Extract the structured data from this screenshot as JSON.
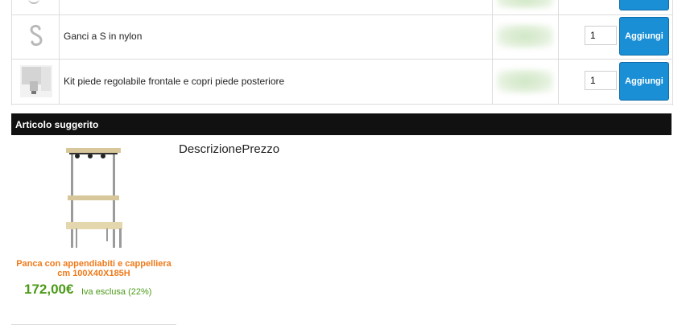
{
  "cart": {
    "rows": [
      {
        "name": "",
        "qty": "",
        "button": ""
      },
      {
        "name": "Ganci a S in nylon",
        "qty": "1",
        "button": "Aggiungi"
      },
      {
        "name": "Kit piede regolabile frontale e copri piede posteriore",
        "qty": "1",
        "button": "Aggiungi"
      }
    ]
  },
  "suggested": {
    "title": "Articolo suggerito",
    "headers": "DescrizionePrezzo",
    "product": {
      "name": "Panca con appendiabiti e cappelliera cm 100X40X185H",
      "price": "172,00€",
      "vat": "Iva esclusa (22%)"
    }
  },
  "colors": {
    "accent": "#1a8fd6",
    "price": "#4c9a18",
    "product_name": "#f07a1a",
    "bar": "#111111"
  }
}
